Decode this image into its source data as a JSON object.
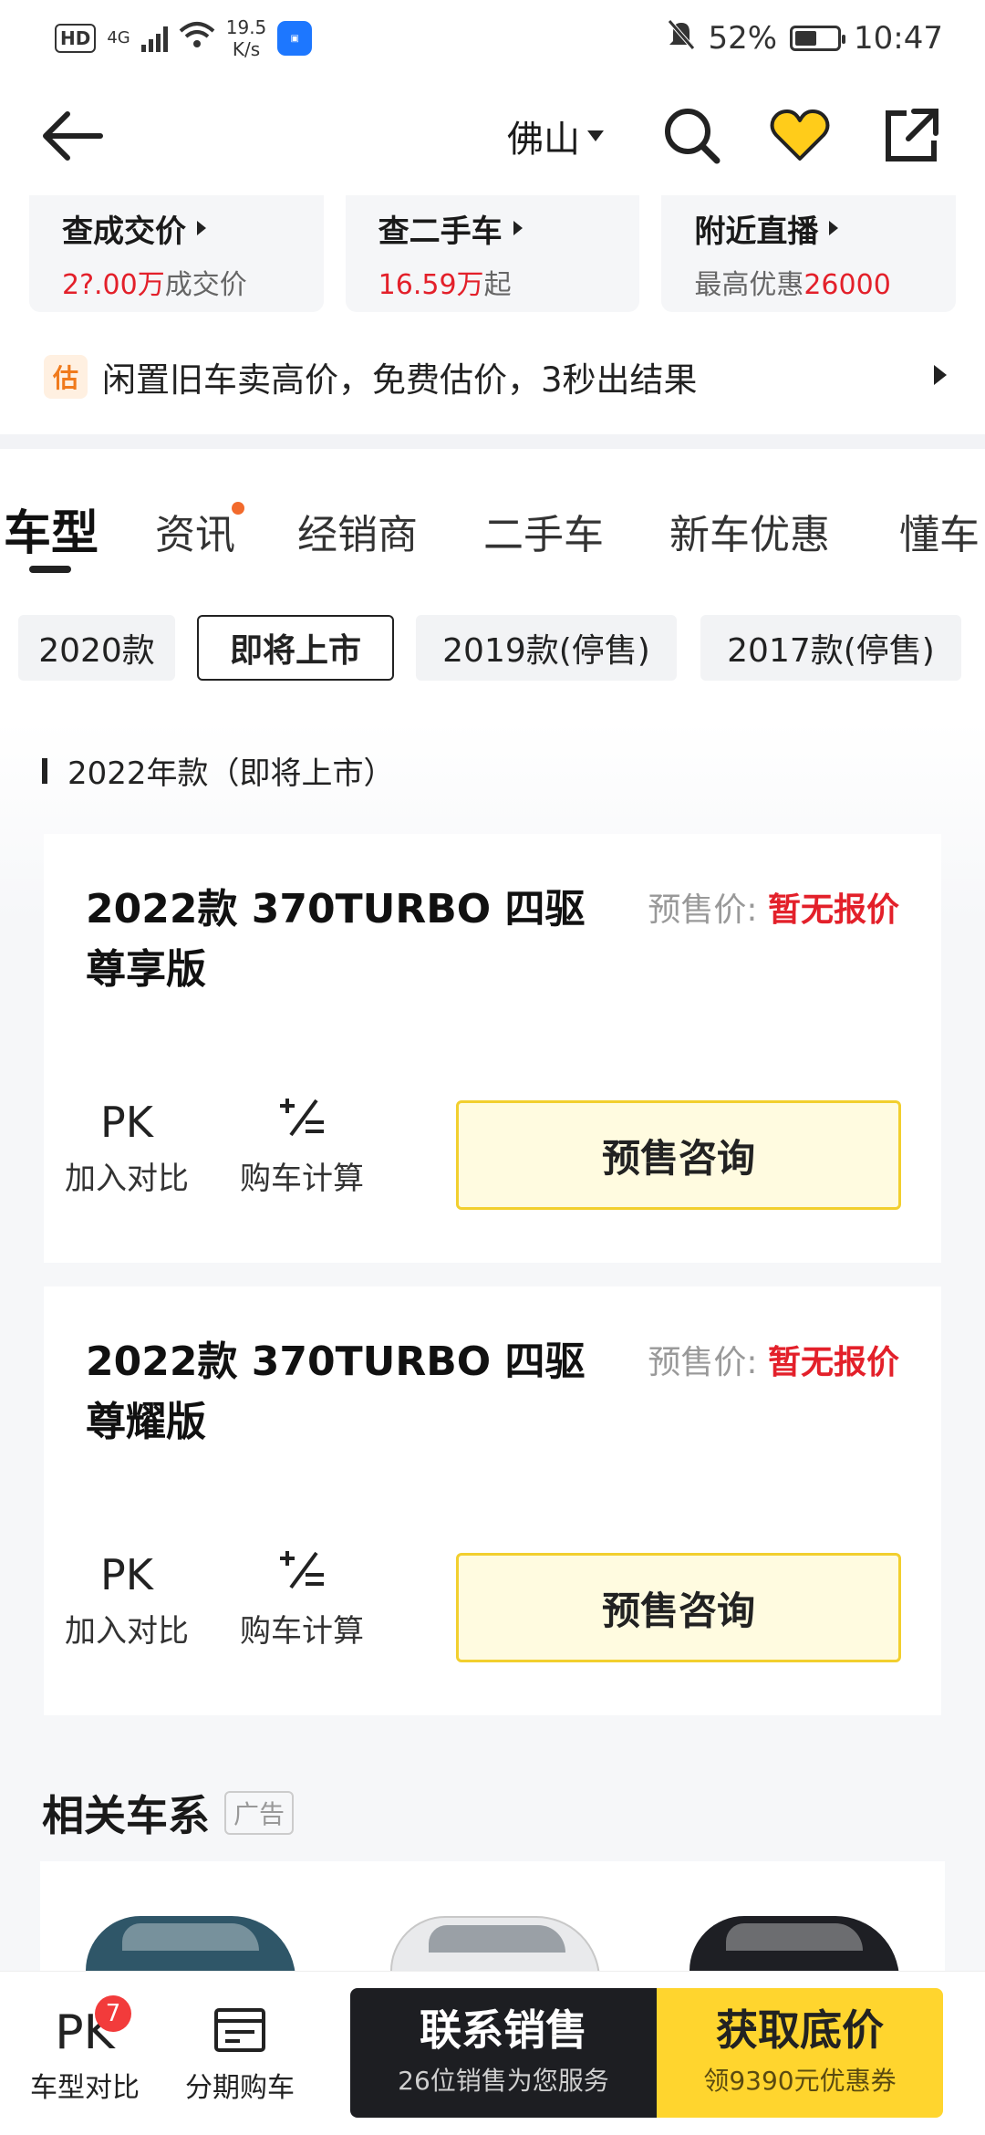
{
  "status_bar": {
    "hd": "HD",
    "network": "4G",
    "speed_value": "19.5",
    "speed_unit": "K/s",
    "battery": "52%",
    "battery_level": 0.52,
    "time": "10:47"
  },
  "header": {
    "city": "佛山"
  },
  "quick_cards": [
    {
      "title": "查成交价",
      "sub_value": "2?.00万",
      "sub_suffix": "成交价",
      "sub_prefix": ""
    },
    {
      "title": "查二手车",
      "sub_value": "16.59万",
      "sub_suffix": "起",
      "sub_prefix": ""
    },
    {
      "title": "附近直播",
      "sub_prefix": "最高优惠",
      "sub_value": "26000",
      "sub_suffix": ""
    }
  ],
  "estimate": {
    "badge": "估",
    "text": "闲置旧车卖高价，免费估价，3秒出结果"
  },
  "tabs": [
    "车型",
    "资讯",
    "经销商",
    "二手车",
    "新车优惠",
    "懂车"
  ],
  "year_chips": [
    "2020款",
    "即将上市",
    "2019款(停售)",
    "2017款(停售)"
  ],
  "section_label": "2022年款（即将上市）",
  "trims": [
    {
      "name": "2022款 370TURBO 四驱尊享版",
      "price_label": "预售价:",
      "price_value": "暂无报价",
      "op_compare_icon": "PK",
      "op_compare": "加入对比",
      "op_calc": "购车计算",
      "cta": "预售咨询"
    },
    {
      "name": "2022款 370TURBO 四驱尊耀版",
      "price_label": "预售价:",
      "price_value": "暂无报价",
      "op_compare_icon": "PK",
      "op_compare": "加入对比",
      "op_calc": "购车计算",
      "cta": "预售咨询"
    }
  ],
  "related": {
    "title": "相关车系",
    "ad_tag": "广告"
  },
  "bottom_bar": {
    "compare_icon": "PK",
    "compare_label": "车型对比",
    "compare_count": "7",
    "installment_label": "分期购车",
    "contact_main": "联系销售",
    "contact_sub": "26位销售为您服务",
    "price_main": "获取底价",
    "price_sub": "领9390元优惠券"
  },
  "colors": {
    "accent_yellow": "#ffd52e",
    "price_red": "#e3202a",
    "dark_button": "#1d1e22"
  }
}
